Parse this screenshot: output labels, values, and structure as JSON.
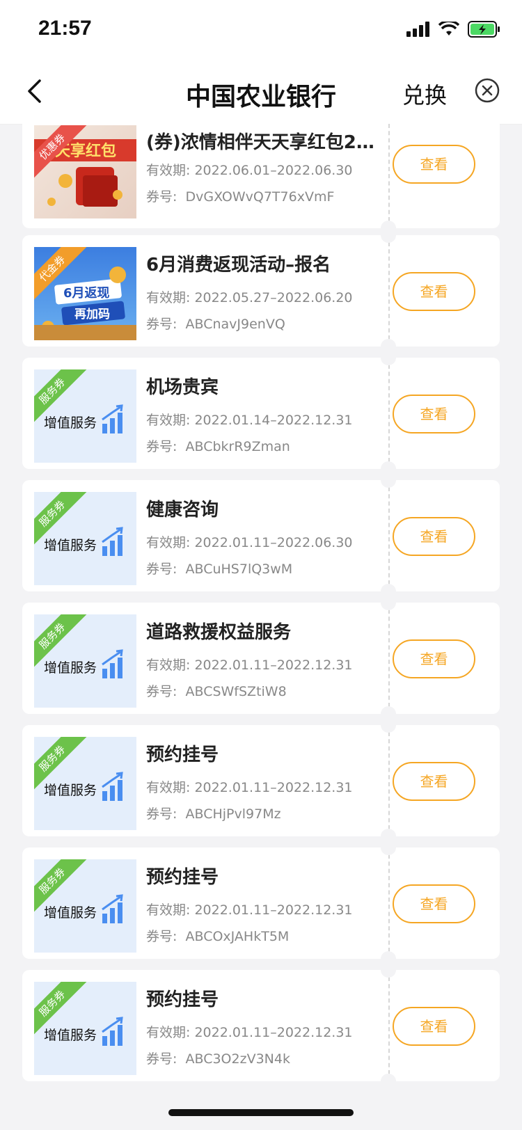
{
  "status": {
    "time": "21:57"
  },
  "nav": {
    "title": "中国农业银行",
    "exchange": "兑换"
  },
  "cards": [
    {
      "ribbon": "优惠券",
      "title": "(券)浓情相伴天天享红包2...",
      "valid_label": "有效期:",
      "valid": "2022.06.01–2022.06.30",
      "code_label": "券号:",
      "code": "DvGXOWvQ7T76xVmF",
      "button": "查看",
      "thumb_text": "天享红包"
    },
    {
      "ribbon": "代金券",
      "title": "6月消费返现活动–报名",
      "valid_label": "有效期:",
      "valid": "2022.05.27–2022.06.20",
      "code_label": "券号:",
      "code": "ABCnavJ9enVQ",
      "button": "查看",
      "thumb_text": "6月返现 再加码"
    },
    {
      "ribbon": "服务券",
      "title": "机场贵宾",
      "valid_label": "有效期:",
      "valid": "2022.01.14–2022.12.31",
      "code_label": "券号:",
      "code": "ABCbkrR9Zman",
      "button": "查看",
      "service": "增值服务"
    },
    {
      "ribbon": "服务券",
      "title": "健康咨询",
      "valid_label": "有效期:",
      "valid": "2022.01.11–2022.06.30",
      "code_label": "券号:",
      "code": "ABCuHS7lQ3wM",
      "button": "查看",
      "service": "增值服务"
    },
    {
      "ribbon": "服务券",
      "title": "道路救援权益服务",
      "valid_label": "有效期:",
      "valid": "2022.01.11–2022.12.31",
      "code_label": "券号:",
      "code": "ABCSWfSZtiW8",
      "button": "查看",
      "service": "增值服务"
    },
    {
      "ribbon": "服务券",
      "title": "预约挂号",
      "valid_label": "有效期:",
      "valid": "2022.01.11–2022.12.31",
      "code_label": "券号:",
      "code": "ABCHjPvl97Mz",
      "button": "查看",
      "service": "增值服务"
    },
    {
      "ribbon": "服务券",
      "title": "预约挂号",
      "valid_label": "有效期:",
      "valid": "2022.01.11–2022.12.31",
      "code_label": "券号:",
      "code": "ABCOxJAHkT5M",
      "button": "查看",
      "service": "增值服务"
    },
    {
      "ribbon": "服务券",
      "title": "预约挂号",
      "valid_label": "有效期:",
      "valid": "2022.01.11–2022.12.31",
      "code_label": "券号:",
      "code": "ABC3O2zV3N4k",
      "button": "查看",
      "service": "增值服务"
    }
  ],
  "colors": {
    "accent": "#f5a623",
    "ribbon_service": "#6cc24a",
    "ribbon_promo": "#e8524a",
    "ribbon_cash": "#f29d2a"
  }
}
